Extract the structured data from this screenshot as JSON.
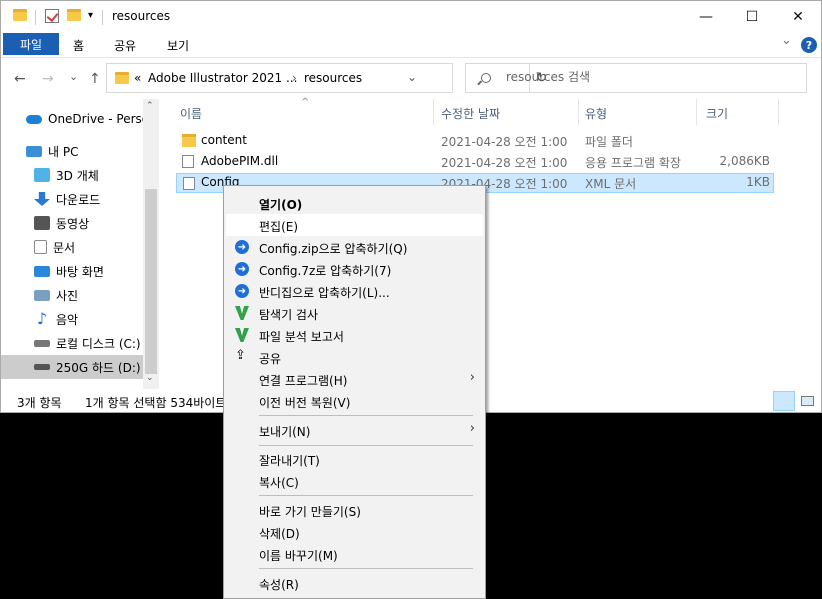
{
  "window": {
    "title": "resources",
    "controls": {
      "minimize": "—",
      "maximize": "☐",
      "close": "✕"
    }
  },
  "ribbon": {
    "file_tab": "파일",
    "tabs": [
      "홈",
      "공유",
      "보기"
    ],
    "expand_chevron": "⌄",
    "help": "?"
  },
  "address": {
    "back": "←",
    "forward": "→",
    "recent": "⌄",
    "up": "↑",
    "overflow": "«",
    "crumbs": [
      "Adobe Illustrator 2021 ...",
      "resources"
    ],
    "crumb_sep": "›",
    "dropdown": "⌄",
    "refresh": "↻",
    "search_placeholder": "resources 검색"
  },
  "nav": {
    "items": [
      {
        "label": "OneDrive - Persor",
        "icon": "cloud-icon",
        "color": "#1e7fd6"
      },
      {
        "label": "내 PC",
        "icon": "pc-icon",
        "color": "#3a8fd6"
      },
      {
        "label": "3D 개체",
        "icon": "3d-objects-icon",
        "color": "#4fb3e8"
      },
      {
        "label": "다운로드",
        "icon": "download-icon",
        "color": "#2a7ad0"
      },
      {
        "label": "동영상",
        "icon": "video-icon",
        "color": "#555555"
      },
      {
        "label": "문서",
        "icon": "document-icon",
        "color": "#8a8a8a"
      },
      {
        "label": "바탕 화면",
        "icon": "desktop-icon",
        "color": "#2a88d8"
      },
      {
        "label": "사진",
        "icon": "pictures-icon",
        "color": "#7aa0c0"
      },
      {
        "label": "음악",
        "icon": "music-icon",
        "color": "#1c6fd0"
      },
      {
        "label": "로컬 디스크 (C:)",
        "icon": "drive-c-icon",
        "color": "#777777"
      },
      {
        "label": "250G 하드 (D:)",
        "icon": "drive-d-icon",
        "color": "#555555"
      }
    ],
    "scroll_up": "⌃",
    "scroll_down": "⌄"
  },
  "files": {
    "columns": [
      "이름",
      "수정한 날짜",
      "유형",
      "크기"
    ],
    "sort_arrow": "^",
    "rows": [
      {
        "name": "content",
        "date": "2021-04-28 오전 1:00",
        "type": "파일 폴더",
        "size": "",
        "icon": "folder-icon"
      },
      {
        "name": "AdobePIM.dll",
        "date": "2021-04-28 오전 1:00",
        "type": "응용 프로그램 확장",
        "size": "2,086KB",
        "icon": "dll-icon"
      },
      {
        "name": "Config",
        "date": "2021-04-28 오전 1:00",
        "type": "XML 문서",
        "size": "1KB",
        "icon": "xml-icon"
      }
    ]
  },
  "status": {
    "count": "3개 항목",
    "selected": "1개 항목 선택함 534바이트"
  },
  "context_menu": {
    "items": [
      {
        "label": "열기(O)",
        "bold": true
      },
      {
        "label": "편집(E)",
        "hover": true
      },
      {
        "label": "Config.zip으로 압축하기(Q)",
        "icon": "bandizip-icon"
      },
      {
        "label": "Config.7z로 압축하기(7)",
        "icon": "bandizip-icon"
      },
      {
        "label": "반디집으로 압축하기(L)...",
        "icon": "bandizip-icon"
      },
      {
        "label": "탐색기 검사",
        "icon": "v3-icon"
      },
      {
        "label": "파일 분석 보고서",
        "icon": "v3-report-icon"
      },
      {
        "label": "공유",
        "icon": "share-icon"
      },
      {
        "label": "연결 프로그램(H)",
        "submenu": "›"
      },
      {
        "label": "이전 버전 복원(V)"
      },
      {
        "label": "보내기(N)",
        "submenu": "›"
      },
      {
        "label": "잘라내기(T)"
      },
      {
        "label": "복사(C)"
      },
      {
        "label": "바로 가기 만들기(S)"
      },
      {
        "label": "삭제(D)"
      },
      {
        "label": "이름 바꾸기(M)"
      },
      {
        "label": "속성(R)"
      }
    ],
    "bandizip_glyph": "➜"
  }
}
